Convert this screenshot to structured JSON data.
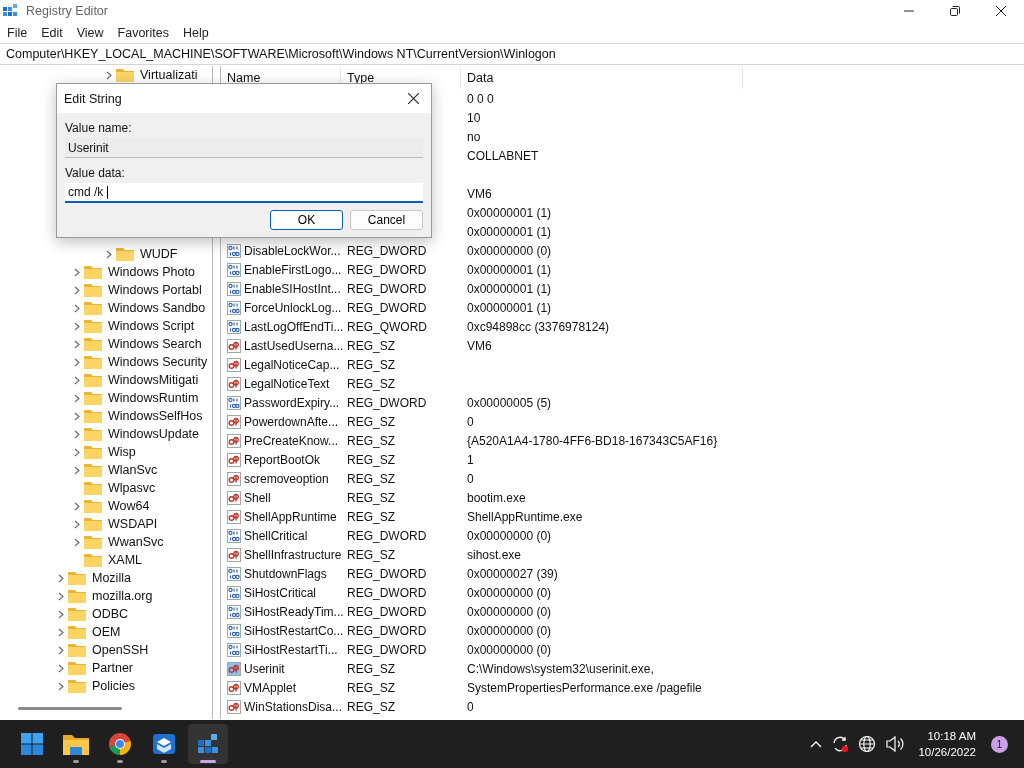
{
  "window": {
    "title": "Registry Editor"
  },
  "menu": [
    "File",
    "Edit",
    "View",
    "Favorites",
    "Help"
  ],
  "address": "Computer\\HKEY_LOCAL_MACHINE\\SOFTWARE\\Microsoft\\Windows NT\\CurrentVersion\\Winlogon",
  "tree": {
    "items": [
      {
        "children": [
          {
            "children": [
              {
                "children": [
                  {
                    "label": "Virtualizati",
                    "expandable": true
                  },
                  {
                    "label": "WUDF",
                    "expandable": true
                  }
                ]
              }
            ]
          },
          {
            "label": "Windows Photo",
            "expandable": true
          },
          {
            "label": "Windows Portabl",
            "expandable": true
          },
          {
            "label": "Windows Sandbo",
            "expandable": true
          },
          {
            "label": "Windows Script",
            "expandable": true
          },
          {
            "label": "Windows Search",
            "expandable": true
          },
          {
            "label": "Windows Security",
            "expandable": true
          },
          {
            "label": "WindowsMitigati",
            "expandable": true
          },
          {
            "label": "WindowsRuntim",
            "expandable": true
          },
          {
            "label": "WindowsSelfHos",
            "expandable": true
          },
          {
            "label": "WindowsUpdate",
            "expandable": true
          },
          {
            "label": "Wisp",
            "expandable": true
          },
          {
            "label": "WlanSvc",
            "expandable": true
          },
          {
            "label": "Wlpasvc",
            "expandable": false
          },
          {
            "label": "Wow64",
            "expandable": true
          },
          {
            "label": "WSDAPI",
            "expandable": true
          },
          {
            "label": "WwanSvc",
            "expandable": true
          },
          {
            "label": "XAML",
            "expandable": false
          }
        ]
      },
      {
        "label": "Mozilla",
        "expandable": true
      },
      {
        "label": "mozilla.org",
        "expandable": true
      },
      {
        "label": "ODBC",
        "expandable": true
      },
      {
        "label": "OEM",
        "expandable": true
      },
      {
        "label": "OpenSSH",
        "expandable": true
      },
      {
        "label": "Partner",
        "expandable": true
      },
      {
        "label": "Policies",
        "expandable": true
      }
    ]
  },
  "table": {
    "columns": [
      "Name",
      "Type",
      "Data"
    ],
    "rows": [
      {
        "data": "0 0 0"
      },
      {
        "data": "10"
      },
      {
        "data": "no"
      },
      {
        "data": "COLLABNET"
      },
      {},
      {
        "data": "VM6"
      },
      {
        "data": "0x00000001 (1)"
      },
      {
        "data": "0x00000001 (1)"
      },
      {
        "kind": "binary",
        "name": "DisableLockWor...",
        "type": "REG_DWORD",
        "data": "0x00000000 (0)",
        "selected": false
      },
      {
        "kind": "binary",
        "name": "EnableFirstLogo...",
        "type": "REG_DWORD",
        "data": "0x00000001 (1)",
        "selected": false
      },
      {
        "kind": "binary",
        "name": "EnableSIHostInt...",
        "type": "REG_DWORD",
        "data": "0x00000001 (1)",
        "selected": false
      },
      {
        "kind": "binary",
        "name": "ForceUnlockLog...",
        "type": "REG_DWORD",
        "data": "0x00000001 (1)",
        "selected": false
      },
      {
        "kind": "binary",
        "name": "LastLogOffEndTi...",
        "type": "REG_QWORD",
        "data": "0xc94898cc (3376978124)",
        "selected": false
      },
      {
        "kind": "string",
        "name": "LastUsedUserna...",
        "type": "REG_SZ",
        "data": "VM6",
        "selected": false
      },
      {
        "kind": "string",
        "name": "LegalNoticeCap...",
        "type": "REG_SZ",
        "selected": false
      },
      {
        "kind": "string",
        "name": "LegalNoticeText",
        "type": "REG_SZ",
        "selected": false
      },
      {
        "kind": "binary",
        "name": "PasswordExpiry...",
        "type": "REG_DWORD",
        "data": "0x00000005 (5)",
        "selected": false
      },
      {
        "kind": "string",
        "name": "PowerdownAfte...",
        "type": "REG_SZ",
        "data": "0",
        "selected": false
      },
      {
        "kind": "string",
        "name": "PreCreateKnow...",
        "type": "REG_SZ",
        "data": "{A520A1A4-1780-4FF6-BD18-167343C5AF16}",
        "selected": false
      },
      {
        "kind": "string",
        "name": "ReportBootOk",
        "type": "REG_SZ",
        "data": "1",
        "selected": false
      },
      {
        "kind": "string",
        "name": "scremoveoption",
        "type": "REG_SZ",
        "data": "0",
        "selected": false
      },
      {
        "kind": "string",
        "name": "Shell",
        "type": "REG_SZ",
        "data": "bootim.exe",
        "selected": false
      },
      {
        "kind": "string",
        "name": "ShellAppRuntime",
        "type": "REG_SZ",
        "data": "ShellAppRuntime.exe",
        "selected": false
      },
      {
        "kind": "binary",
        "name": "ShellCritical",
        "type": "REG_DWORD",
        "data": "0x00000000 (0)",
        "selected": false
      },
      {
        "kind": "string",
        "name": "ShellInfrastructure",
        "type": "REG_SZ",
        "data": "sihost.exe",
        "selected": false
      },
      {
        "kind": "binary",
        "name": "ShutdownFlags",
        "type": "REG_DWORD",
        "data": "0x00000027 (39)",
        "selected": false
      },
      {
        "kind": "binary",
        "name": "SiHostCritical",
        "type": "REG_DWORD",
        "data": "0x00000000 (0)",
        "selected": false
      },
      {
        "kind": "binary",
        "name": "SiHostReadyTim...",
        "type": "REG_DWORD",
        "data": "0x00000000 (0)",
        "selected": false
      },
      {
        "kind": "binary",
        "name": "SiHostRestartCo...",
        "type": "REG_DWORD",
        "data": "0x00000000 (0)",
        "selected": false
      },
      {
        "kind": "binary",
        "name": "SiHostRestartTi...",
        "type": "REG_DWORD",
        "data": "0x00000000 (0)",
        "selected": false
      },
      {
        "kind": "string",
        "name": "Userinit",
        "type": "REG_SZ",
        "data": "C:\\Windows\\system32\\userinit.exe,",
        "selected": true
      },
      {
        "kind": "string",
        "name": "VMApplet",
        "type": "REG_SZ",
        "data": "SystemPropertiesPerformance.exe /pagefile",
        "selected": false
      },
      {
        "kind": "string",
        "name": "WinStationsDisa...",
        "type": "REG_SZ",
        "data": "0",
        "selected": false
      }
    ]
  },
  "dialog": {
    "title": "Edit String",
    "fields": [
      {
        "label": "Value name:",
        "value": "Userinit",
        "readonly": true,
        "focused": false
      },
      {
        "label": "Value data:",
        "value": "cmd /k ",
        "readonly": false,
        "focused": true
      }
    ],
    "buttons": [
      {
        "label": "OK",
        "default": true
      },
      {
        "label": "Cancel",
        "default": false
      }
    ]
  },
  "taskbar": {
    "apps": [
      {
        "kind": "start",
        "running": false,
        "selected": false
      },
      {
        "kind": "folder",
        "running": true,
        "selected": false
      },
      {
        "kind": "browser",
        "running": true,
        "selected": false
      },
      {
        "kind": "box",
        "running": true,
        "selected": false
      },
      {
        "kind": "registry",
        "running": true,
        "selected": true
      }
    ],
    "time": "10:18 AM",
    "date": "10/26/2022",
    "notifications": "1"
  }
}
